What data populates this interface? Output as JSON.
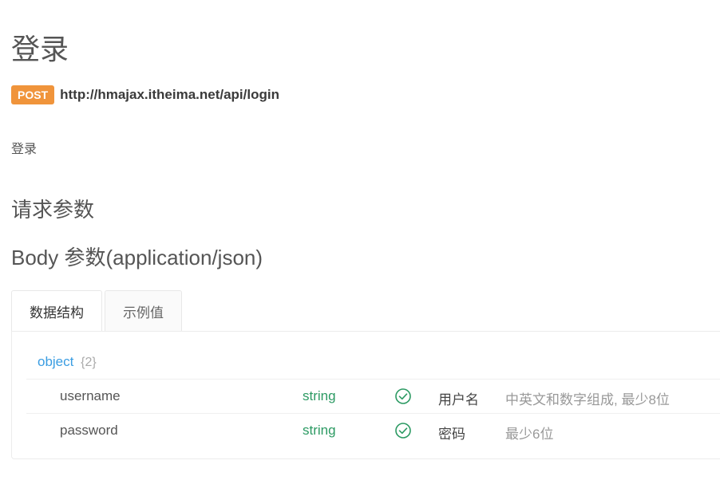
{
  "page": {
    "title": "登录"
  },
  "endpoint": {
    "method": "POST",
    "url": "http://hmajax.itheima.net/api/login"
  },
  "description": "登录",
  "request_params": {
    "title": "请求参数"
  },
  "body_params": {
    "title": "Body 参数(application/json)"
  },
  "tabs": [
    {
      "label": "数据结构",
      "active": true
    },
    {
      "label": "示例值",
      "active": false
    }
  ],
  "schema": {
    "root_type": "object",
    "root_count": "{2}",
    "fields": [
      {
        "name": "username",
        "type": "string",
        "required_icon": "check-circle-icon",
        "label": "用户名",
        "desc": "中英文和数字组成, 最少8位"
      },
      {
        "name": "password",
        "type": "string",
        "required_icon": "check-circle-icon",
        "label": "密码",
        "desc": "最少6位"
      }
    ]
  },
  "colors": {
    "method_badge": "#f0943b",
    "object_type": "#3a9de2",
    "string_type": "#2c9a63",
    "check_icon": "#2c9a63"
  }
}
